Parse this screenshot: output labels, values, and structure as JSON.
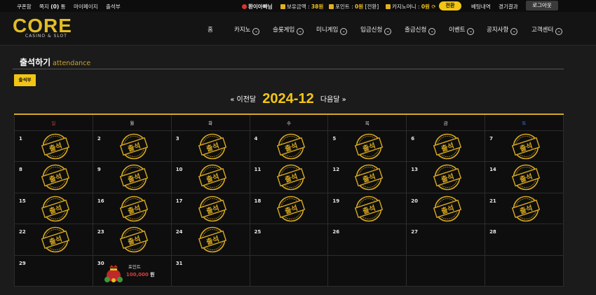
{
  "topbar": {
    "links": [
      "쿠폰함",
      "쪽지",
      "(0)",
      "통",
      "마이페이지",
      "출석부"
    ],
    "user": "환이아빠님",
    "balance_label": "보유금액 :",
    "balance_value": "38원",
    "point_label": "포인트 :",
    "point_value": "0원",
    "point_convert": "[전환]",
    "casino_money_label": "카지노머니 :",
    "casino_money_value": "0원",
    "exchange_button": "전환",
    "bet_history": "베팅내역",
    "results": "경기결과",
    "logout": "로그아웃"
  },
  "brand": {
    "logo_text": "CORE",
    "logo_tagline": "CASINO & SLOT"
  },
  "nav": [
    "홈",
    "카지노",
    "슬롯게임",
    "미니게임",
    "입금신청",
    "출금신청",
    "이벤트",
    "공지사항",
    "고객센터"
  ],
  "page": {
    "title": "출석하기",
    "subtitle": "attendance",
    "attendance_button": "출석부",
    "prev_month": "« 이전달",
    "current_month": "2024-12",
    "next_month": "다음달 »",
    "stamp_text": "출석",
    "reward_label": "포인트",
    "reward_amount": "100,000",
    "reward_unit": "원"
  },
  "calendar": {
    "weekdays": [
      "일",
      "월",
      "화",
      "수",
      "목",
      "금",
      "토"
    ],
    "weeks": [
      [
        {
          "d": "1",
          "s": true
        },
        {
          "d": "2",
          "s": true
        },
        {
          "d": "3",
          "s": true
        },
        {
          "d": "4",
          "s": true
        },
        {
          "d": "5",
          "s": true
        },
        {
          "d": "6",
          "s": true
        },
        {
          "d": "7",
          "s": true
        }
      ],
      [
        {
          "d": "8",
          "s": true
        },
        {
          "d": "9",
          "s": true
        },
        {
          "d": "10",
          "s": true
        },
        {
          "d": "11",
          "s": true
        },
        {
          "d": "12",
          "s": true
        },
        {
          "d": "13",
          "s": true
        },
        {
          "d": "14",
          "s": true
        }
      ],
      [
        {
          "d": "15",
          "s": true
        },
        {
          "d": "16",
          "s": true
        },
        {
          "d": "17",
          "s": true
        },
        {
          "d": "18",
          "s": true
        },
        {
          "d": "19",
          "s": true
        },
        {
          "d": "20",
          "s": true
        },
        {
          "d": "21",
          "s": true
        }
      ],
      [
        {
          "d": "22",
          "s": true
        },
        {
          "d": "23",
          "s": true
        },
        {
          "d": "24",
          "s": true
        },
        {
          "d": "25",
          "s": false
        },
        {
          "d": "26",
          "s": false
        },
        {
          "d": "27",
          "s": false
        },
        {
          "d": "28",
          "s": false
        }
      ],
      [
        {
          "d": "29",
          "s": false
        },
        {
          "d": "30",
          "s": false,
          "reward": true
        },
        {
          "d": "31",
          "s": false
        },
        {
          "d": "",
          "s": false
        },
        {
          "d": "",
          "s": false
        },
        {
          "d": "",
          "s": false
        },
        {
          "d": "",
          "s": false
        }
      ]
    ]
  },
  "colors": {
    "accent": "#f3c614",
    "stamp": "#d8a91f",
    "sunday": "#e23a3a",
    "saturday": "#3a78e2"
  }
}
